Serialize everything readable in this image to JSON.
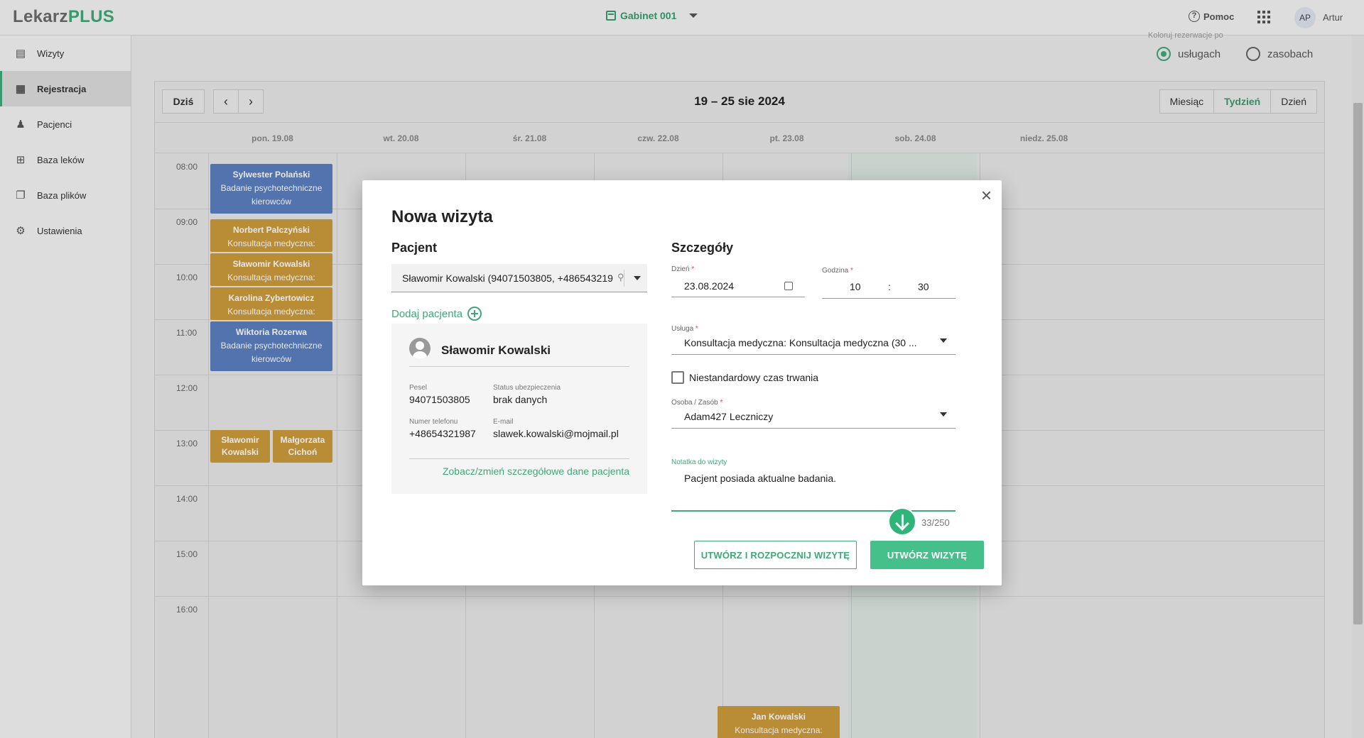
{
  "header": {
    "logo_part1": "Lekarz",
    "logo_part2": "PLUS",
    "cabinet": "Gabinet 001",
    "help": "Pomoc",
    "avatar_initials": "AP",
    "user_name": "Artur"
  },
  "sidebar": {
    "items": [
      {
        "label": "Wizyty",
        "icon": "clipboard-icon"
      },
      {
        "label": "Rejestracja",
        "icon": "calendar-icon",
        "active": true
      },
      {
        "label": "Pacjenci",
        "icon": "users-icon"
      },
      {
        "label": "Baza leków",
        "icon": "medical-kit-icon"
      },
      {
        "label": "Baza plików",
        "icon": "files-icon"
      },
      {
        "label": "Ustawienia",
        "icon": "gear-icon"
      }
    ]
  },
  "legend": {
    "label": "Koloruj rezerwacje po",
    "option_services": "usługach",
    "option_resources": "zasobach",
    "selected": "usługach"
  },
  "calendar": {
    "today_label": "Dziś",
    "title": "19 – 25 sie 2024",
    "views": [
      "Miesiąc",
      "Tydzień",
      "Dzień"
    ],
    "active_view": "Tydzień",
    "days": [
      "pon. 19.08",
      "wt. 20.08",
      "śr. 21.08",
      "czw. 22.08",
      "pt. 23.08",
      "sob. 24.08",
      "niedz. 25.08"
    ],
    "hours": [
      "08:00",
      "09:00",
      "10:00",
      "11:00",
      "12:00",
      "13:00",
      "14:00",
      "15:00",
      "16:00"
    ],
    "events": [
      {
        "name": "Sylwester Polański",
        "desc": "Badanie psychotechniczne kierowców",
        "color": "#5b7fc0"
      },
      {
        "name": "Norbert Palczyński",
        "desc": "Konsultacja medyczna:",
        "color": "#cc9a3c"
      },
      {
        "name": "Sławomir Kowalski",
        "desc": "Konsultacja medyczna:",
        "color": "#cc9a3c"
      },
      {
        "name": "Karolina Zybertowicz",
        "desc": "Konsultacja medyczna:",
        "color": "#cc9a3c"
      },
      {
        "name": "Wiktoria Rozerwa",
        "desc": "Badanie psychotechniczne kierowców",
        "color": "#5b7fc0"
      },
      {
        "name": "Sławomir Kowalski",
        "desc": "",
        "color": "#cc9a3c"
      },
      {
        "name": "Małgorzata Cichoń",
        "desc": "",
        "color": "#cc9a3c"
      },
      {
        "name": "Jan Kowalski",
        "desc": "Konsultacja medyczna:",
        "color": "#cc9a3c"
      }
    ]
  },
  "dialog": {
    "title": "Nowa wizyta",
    "patient_section": "Pacjent",
    "patient_value": "Sławomir Kowalski (94071503805, +486543219",
    "add_patient": "Dodaj pacjenta",
    "patient": {
      "name": "Sławomir Kowalski",
      "pesel_label": "Pesel",
      "pesel": "94071503805",
      "insurance_label": "Status ubezpieczenia",
      "insurance": "brak danych",
      "phone_label": "Numer telefonu",
      "phone": "+48654321987",
      "email_label": "E-mail",
      "email": "slawek.kowalski@mojmail.pl",
      "details_link": "Zobacz/zmień szczegółowe dane pacjenta"
    },
    "details_section": "Szczegóły",
    "day_label": "Dzień",
    "day_value": "23.08.2024",
    "time_label": "Godzina",
    "hour": "10",
    "time_sep": ":",
    "minute": "30",
    "service_label": "Usługa",
    "service_value": "Konsultacja medyczna: Konsultacja medyczna (30 ...",
    "custom_duration": "Niestandardowy czas trwania",
    "person_label": "Osoba / Zasób",
    "person_value": "Adam427 Leczniczy",
    "note_label": "Notatka do wizyty",
    "note_value": "Pacjent posiada aktualne badania.",
    "note_counter": "33/250",
    "btn_create_start": "UTWÓRZ I ROZPOCZNIJ WIZYTĘ",
    "btn_create": "UTWÓRZ WIZYTĘ",
    "required_mark": "*"
  },
  "colors": {
    "accent": "#3fa877",
    "event_blue": "#5b7fc0",
    "event_orange": "#cc9a3c"
  }
}
